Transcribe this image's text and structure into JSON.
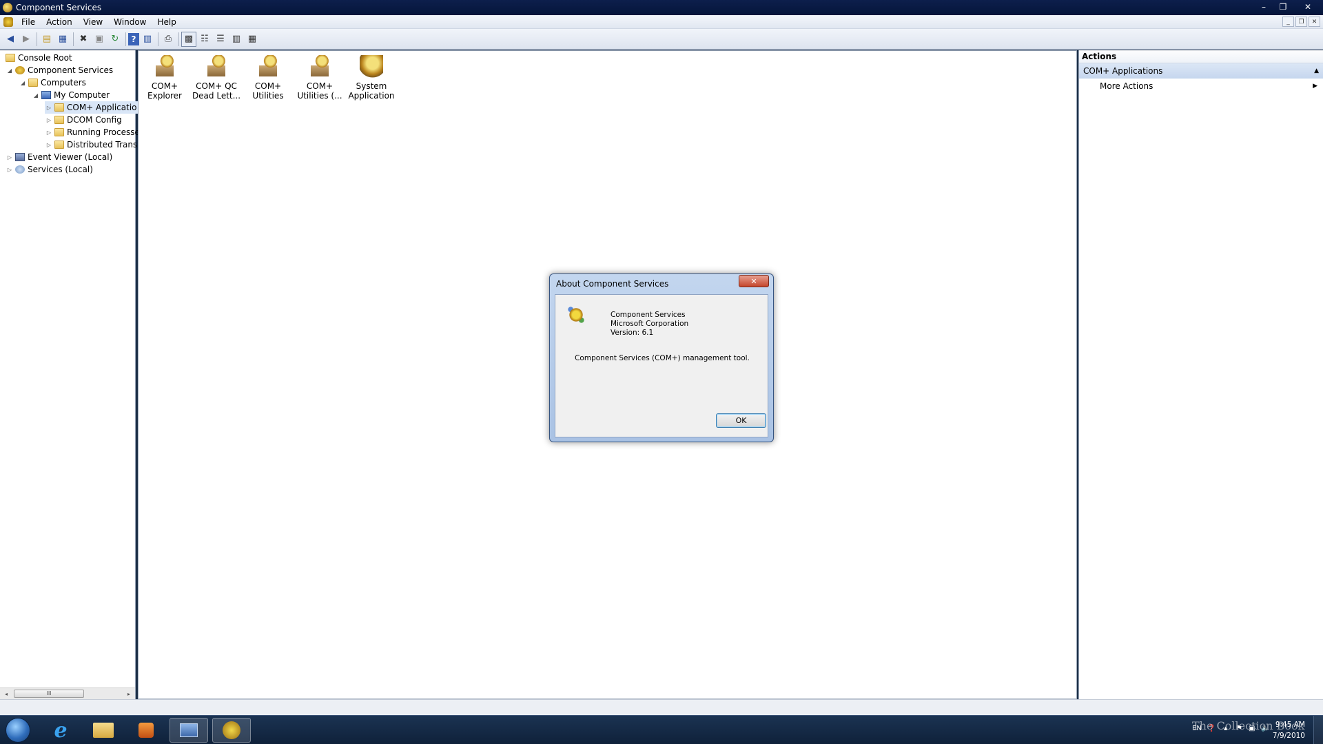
{
  "window": {
    "title": "Component Services",
    "controls": {
      "minimize": "–",
      "restore": "❐",
      "close": "✕"
    }
  },
  "menu": {
    "items": [
      "File",
      "Action",
      "View",
      "Window",
      "Help"
    ],
    "mdi_controls": [
      "_",
      "❐",
      "✕"
    ]
  },
  "toolbar": {
    "icons": [
      "back-arrow-icon",
      "forward-arrow-icon",
      "up-folder-icon",
      "show-hide-tree-icon",
      "delete-icon",
      "properties-icon",
      "refresh-icon",
      "help-icon",
      "show-hide-action-pane-icon",
      "export-list-icon",
      "large-icons-view-icon",
      "small-icons-view-icon",
      "list-view-icon",
      "detail-view-icon",
      "filter-view-icon"
    ]
  },
  "tree": {
    "items": [
      {
        "label": "Console Root",
        "icon": "folder-icon",
        "expander": ""
      },
      {
        "label": "Component Services",
        "icon": "component-services-icon",
        "expander": "◢"
      },
      {
        "label": "Computers",
        "icon": "folder-icon",
        "expander": "◢"
      },
      {
        "label": "My Computer",
        "icon": "computer-icon",
        "expander": "◢"
      },
      {
        "label": "COM+ Applicatio",
        "icon": "folder-icon",
        "expander": "▷"
      },
      {
        "label": "DCOM Config",
        "icon": "folder-icon",
        "expander": "▷"
      },
      {
        "label": "Running Processe",
        "icon": "folder-icon",
        "expander": "▷"
      },
      {
        "label": "Distributed Trans",
        "icon": "folder-icon",
        "expander": "▷"
      },
      {
        "label": "Event Viewer (Local)",
        "icon": "event-viewer-icon",
        "expander": "▷"
      },
      {
        "label": "Services (Local)",
        "icon": "services-icon",
        "expander": "▷"
      }
    ],
    "scroll": {
      "left": "◂",
      "right": "▸",
      "thumb": "III"
    }
  },
  "center": {
    "apps": [
      {
        "line1": "COM+",
        "line2": "Explorer"
      },
      {
        "line1": "COM+ QC",
        "line2": "Dead Lett..."
      },
      {
        "line1": "COM+",
        "line2": "Utilities"
      },
      {
        "line1": "COM+",
        "line2": "Utilities (..."
      },
      {
        "line1": "System",
        "line2": "Application"
      }
    ]
  },
  "actions": {
    "header": "Actions",
    "section": "COM+ Applications",
    "section_toggle": "▲",
    "items": [
      {
        "label": "More Actions",
        "arrow": "▶"
      }
    ]
  },
  "dialog": {
    "title": "About Component Services",
    "close": "✕",
    "product": "Component Services",
    "company": "Microsoft Corporation",
    "version": "Version: 6.1",
    "description": "Component Services (COM+) management tool.",
    "ok": "OK"
  },
  "taskbar": {
    "ie_glyph": "e",
    "tray": {
      "language": "EN",
      "time": "9:45 AM",
      "date": "7/9/2010"
    },
    "watermark": "The Collection Book"
  }
}
